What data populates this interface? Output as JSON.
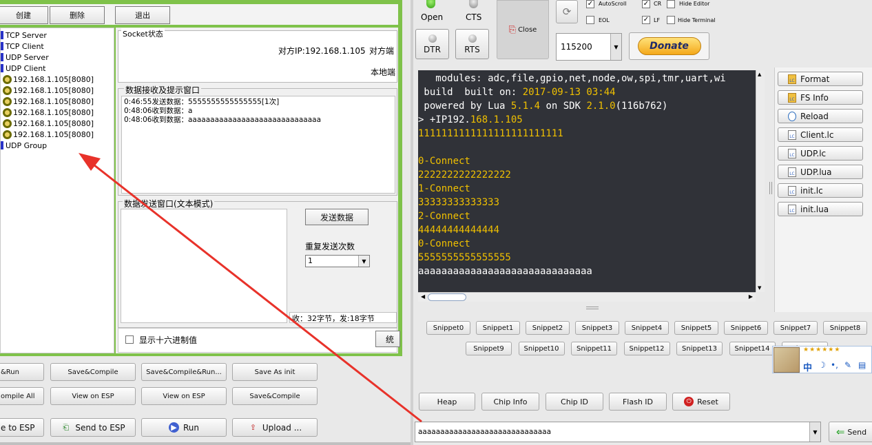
{
  "left_toolbar": {
    "create": "创建",
    "delete": "删除",
    "exit": "退出"
  },
  "tree": {
    "items": [
      {
        "label": "TCP Server",
        "kind": "bar"
      },
      {
        "label": "TCP Client",
        "kind": "bar"
      },
      {
        "label": "UDP Server",
        "kind": "bar"
      },
      {
        "label": "UDP Client",
        "kind": "bar"
      },
      {
        "label": "192.168.1.105[8080]",
        "kind": "ring"
      },
      {
        "label": "192.168.1.105[8080]",
        "kind": "ring"
      },
      {
        "label": "192.168.1.105[8080]",
        "kind": "ring"
      },
      {
        "label": "192.168.1.105[8080]",
        "kind": "ring"
      },
      {
        "label": "192.168.1.105[8080]",
        "kind": "ring"
      },
      {
        "label": "192.168.1.105[8080]",
        "kind": "ring"
      },
      {
        "label": "UDP Group",
        "kind": "bar"
      }
    ]
  },
  "socket": {
    "title": "Socket状态",
    "peer_ip": "对方IP:192.168.1.105",
    "peer_port": "对方端",
    "local_port": "本地端"
  },
  "recv": {
    "title": "数据接收及提示窗口",
    "lines": [
      "0:46:55发送数据：5555555555555555[1次]",
      "0:48:06收到数据：a",
      "0:48:06收到数据：aaaaaaaaaaaaaaaaaaaaaaaaaaaaaa"
    ]
  },
  "send": {
    "title": "数据发送窗口(文本模式)",
    "send_button": "发送数据",
    "repeat_label": "重复发送次数",
    "repeat_value": "1",
    "stats": "收：32字节，发:18字节",
    "hex_label": "显示十六进制值",
    "stat_button": "统"
  },
  "esp_buttons": {
    "row1": [
      "&Run",
      "Save&Compile",
      "Save&Compile&Run...",
      "Save As init"
    ],
    "row2": [
      "ompile All",
      "View on ESP",
      "View on ESP",
      "Save&Compile"
    ],
    "row3": [
      "e to ESP",
      "Send to ESP",
      "Run",
      "Upload ..."
    ]
  },
  "controls": {
    "open": "Open",
    "cts": "CTS",
    "close": "Close",
    "dtr": "DTR",
    "rts": "RTS",
    "autoscroll": "AutoScroll",
    "cr": "CR",
    "hide_editor": "Hide Editor",
    "eol": "EOL",
    "lf": "LF",
    "hide_terminal": "Hide Terminal",
    "baud": "115200",
    "donate": "Donate"
  },
  "terminal": {
    "lines": [
      [
        {
          "t": "   modules: adc,file,gpio,net,node,ow,spi,tmr,uart,wi",
          "c": "w"
        }
      ],
      [
        {
          "t": " build  built on: ",
          "c": "w"
        },
        {
          "t": "2017-09-13 03:44",
          "c": "y"
        }
      ],
      [
        {
          "t": " powered by Lua ",
          "c": "w"
        },
        {
          "t": "5.1.4",
          "c": "y"
        },
        {
          "t": " on SDK ",
          "c": "w"
        },
        {
          "t": "2.1.0",
          "c": "y"
        },
        {
          "t": "(116b762)",
          "c": "w"
        }
      ],
      [
        {
          "t": "> +IP192.",
          "c": "w"
        },
        {
          "t": "168.1.105",
          "c": "y"
        }
      ],
      [
        {
          "t": "1111111111111111111111111",
          "c": "y"
        }
      ],
      [
        {
          "t": "",
          "c": "w"
        }
      ],
      [
        {
          "t": "0-Connect",
          "c": "y"
        }
      ],
      [
        {
          "t": "2222222222222222",
          "c": "y"
        }
      ],
      [
        {
          "t": "1-Connect",
          "c": "y"
        }
      ],
      [
        {
          "t": "33333333333333",
          "c": "y"
        }
      ],
      [
        {
          "t": "2-Connect",
          "c": "y"
        }
      ],
      [
        {
          "t": "44444444444444",
          "c": "y"
        }
      ],
      [
        {
          "t": "0-Connect",
          "c": "y"
        }
      ],
      [
        {
          "t": "5555555555555555",
          "c": "y"
        }
      ],
      [
        {
          "t": "aaaaaaaaaaaaaaaaaaaaaaaaaaaaaa",
          "c": "w"
        }
      ]
    ]
  },
  "files": [
    "Format",
    "FS Info",
    "Reload",
    "Client.lc",
    "UDP.lc",
    "UDP.lua",
    "init.lc",
    "init.lua"
  ],
  "snippets_row1": [
    "Snippet0",
    "Snippet1",
    "Snippet2",
    "Snippet3",
    "Snippet4",
    "Snippet5",
    "Snippet6",
    "Snippet7",
    "Snippet8"
  ],
  "snippets_row2": [
    "Snippet9",
    "Snippet10",
    "Snippet11",
    "Snippet12",
    "Snippet13",
    "Snippet14",
    "Snippet15"
  ],
  "ime": "中",
  "bottom": {
    "heap": "Heap",
    "chip_info": "Chip Info",
    "chip_id": "Chip ID",
    "flash_id": "Flash ID",
    "reset": "Reset"
  },
  "command": {
    "value": "aaaaaaaaaaaaaaaaaaaaaaaaaaaaaa",
    "send": "Send"
  },
  "colors": {
    "green_frame": "#7fc24a",
    "terminal_bg": "#303238",
    "yellow": "#f0c000",
    "arrow": "#e8322a"
  }
}
